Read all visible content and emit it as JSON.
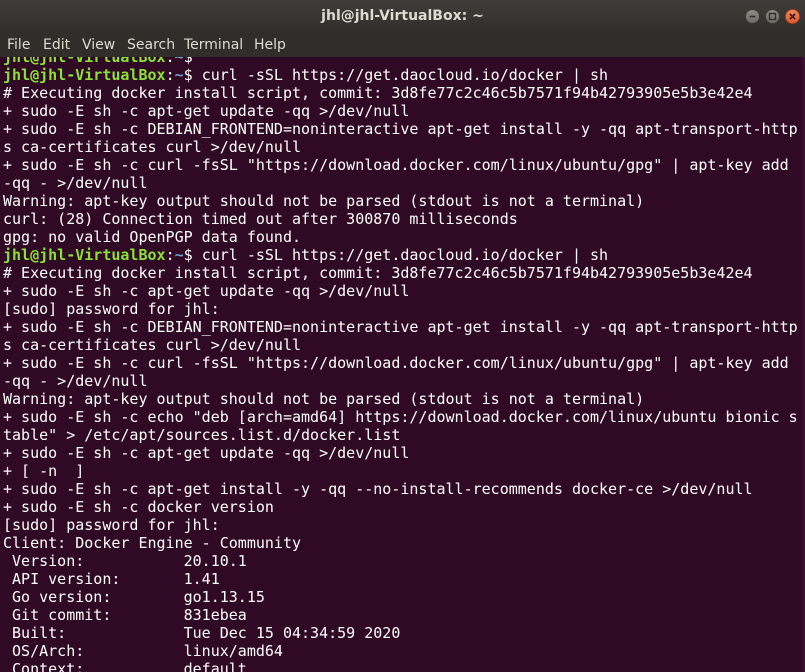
{
  "window": {
    "title": "jhl@jhl-VirtualBox: ~"
  },
  "menu": [
    "File",
    "Edit",
    "View",
    "Search",
    "Terminal",
    "Help"
  ],
  "terminal": {
    "prompt_user": "jhl@jhl-VirtualBox",
    "prompt_sep": ":",
    "prompt_path": "~",
    "prompt_end": "$ ",
    "lines": [
      {
        "type": "prompt",
        "cmd": ""
      },
      {
        "type": "prompt",
        "cmd": "curl -sSL https://get.daocloud.io/docker | sh"
      },
      {
        "type": "text",
        "text": "# Executing docker install script, commit: 3d8fe77c2c46c5b7571f94b42793905e5b3e42e4"
      },
      {
        "type": "text",
        "text": "+ sudo -E sh -c apt-get update -qq >/dev/null"
      },
      {
        "type": "text",
        "text": "+ sudo -E sh -c DEBIAN_FRONTEND=noninteractive apt-get install -y -qq apt-transport-http"
      },
      {
        "type": "text",
        "text": "s ca-certificates curl >/dev/null"
      },
      {
        "type": "text",
        "text": "+ sudo -E sh -c curl -fsSL \"https://download.docker.com/linux/ubuntu/gpg\" | apt-key add"
      },
      {
        "type": "text",
        "text": "-qq - >/dev/null"
      },
      {
        "type": "text",
        "text": "Warning: apt-key output should not be parsed (stdout is not a terminal)"
      },
      {
        "type": "text",
        "text": "curl: (28) Connection timed out after 300870 milliseconds"
      },
      {
        "type": "text",
        "text": "gpg: no valid OpenPGP data found."
      },
      {
        "type": "prompt",
        "cmd": "curl -sSL https://get.daocloud.io/docker | sh"
      },
      {
        "type": "text",
        "text": "# Executing docker install script, commit: 3d8fe77c2c46c5b7571f94b42793905e5b3e42e4"
      },
      {
        "type": "text",
        "text": "+ sudo -E sh -c apt-get update -qq >/dev/null"
      },
      {
        "type": "text",
        "text": "[sudo] password for jhl:"
      },
      {
        "type": "text",
        "text": "+ sudo -E sh -c DEBIAN_FRONTEND=noninteractive apt-get install -y -qq apt-transport-http"
      },
      {
        "type": "text",
        "text": "s ca-certificates curl >/dev/null"
      },
      {
        "type": "text",
        "text": "+ sudo -E sh -c curl -fsSL \"https://download.docker.com/linux/ubuntu/gpg\" | apt-key add"
      },
      {
        "type": "text",
        "text": "-qq - >/dev/null"
      },
      {
        "type": "text",
        "text": "Warning: apt-key output should not be parsed (stdout is not a terminal)"
      },
      {
        "type": "text",
        "text": "+ sudo -E sh -c echo \"deb [arch=amd64] https://download.docker.com/linux/ubuntu bionic s"
      },
      {
        "type": "text",
        "text": "table\" > /etc/apt/sources.list.d/docker.list"
      },
      {
        "type": "text",
        "text": "+ sudo -E sh -c apt-get update -qq >/dev/null"
      },
      {
        "type": "text",
        "text": "+ [ -n  ]"
      },
      {
        "type": "text",
        "text": "+ sudo -E sh -c apt-get install -y -qq --no-install-recommends docker-ce >/dev/null"
      },
      {
        "type": "text",
        "text": "+ sudo -E sh -c docker version"
      },
      {
        "type": "text",
        "text": "[sudo] password for jhl:"
      },
      {
        "type": "text",
        "text": "Client: Docker Engine - Community"
      },
      {
        "type": "text",
        "text": " Version:           20.10.1"
      },
      {
        "type": "text",
        "text": " API version:       1.41"
      },
      {
        "type": "text",
        "text": " Go version:        go1.13.15"
      },
      {
        "type": "text",
        "text": " Git commit:        831ebea"
      },
      {
        "type": "text",
        "text": " Built:             Tue Dec 15 04:34:59 2020"
      },
      {
        "type": "text",
        "text": " OS/Arch:           linux/amd64"
      },
      {
        "type": "text",
        "text": " Context:           default"
      }
    ]
  },
  "colors": {
    "background": "#300a24",
    "foreground": "#ffffff",
    "prompt_user": "#8ae234",
    "prompt_path": "#729fcf"
  }
}
